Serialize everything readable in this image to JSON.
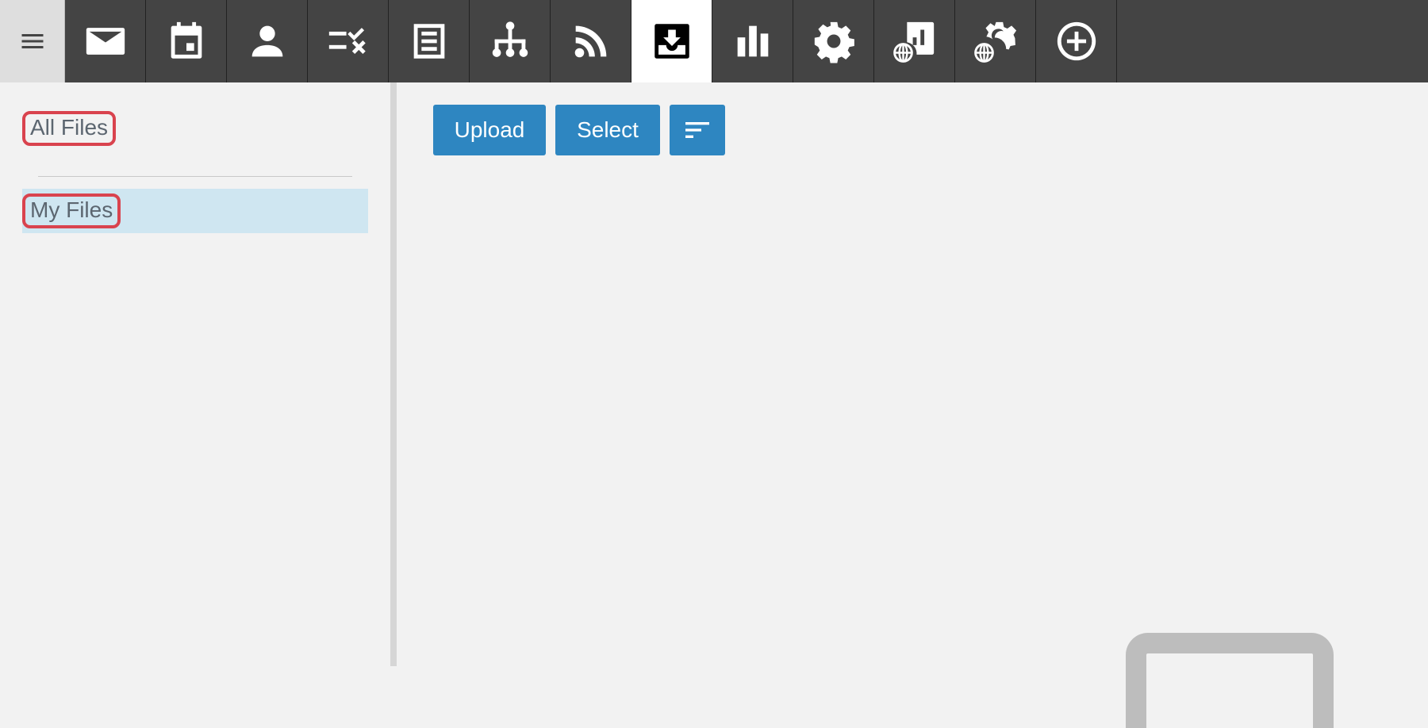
{
  "nav": {
    "items": [
      {
        "icon": "menu-icon"
      },
      {
        "icon": "mail-icon"
      },
      {
        "icon": "calendar-icon"
      },
      {
        "icon": "contacts-icon"
      },
      {
        "icon": "tasks-icon"
      },
      {
        "icon": "notes-icon"
      },
      {
        "icon": "org-chart-icon"
      },
      {
        "icon": "rss-icon"
      },
      {
        "icon": "files-inbox-icon",
        "active": true
      },
      {
        "icon": "bar-chart-icon"
      },
      {
        "icon": "settings-gear-icon"
      },
      {
        "icon": "web-report-icon"
      },
      {
        "icon": "web-settings-icon"
      },
      {
        "icon": "add-circle-icon"
      }
    ]
  },
  "sidebar": {
    "folders": [
      {
        "label": "All Files"
      },
      {
        "label": "My Files",
        "selected": true
      }
    ]
  },
  "toolbar": {
    "upload_label": "Upload",
    "select_label": "Select",
    "sort_icon": "sort-icon"
  },
  "colors": {
    "topbar": "#444444",
    "accent": "#2e86c1",
    "selection": "#cfe6f1",
    "highlight_ring": "#d9434e"
  }
}
